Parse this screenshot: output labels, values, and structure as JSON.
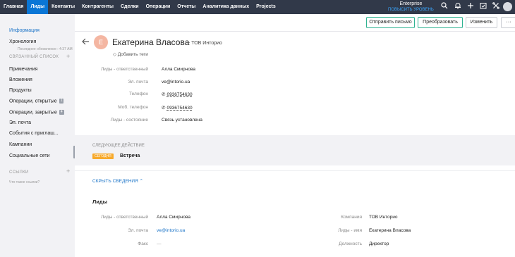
{
  "nav": {
    "items": [
      "Главная",
      "Лиды",
      "Контакты",
      "Контрагенты",
      "Сделки",
      "Операции",
      "Отчеты",
      "Аналитика данных",
      "Projects"
    ],
    "active_index": 1,
    "plan_name": "Enterprise",
    "plan_upgrade": "ПОВЫСИТЬ УРОВЕНЬ",
    "icons": [
      "search-icon",
      "bell-icon",
      "plus-icon",
      "calendar-check-icon",
      "tools-icon",
      "avatar"
    ]
  },
  "sidebar": {
    "info": "Информация",
    "timeline": "Хронология",
    "timeline_updated": "Последнее обновление : 4:37 AM",
    "related_header": "СВЯЗАННЫЙ СПИСОК",
    "related": [
      {
        "label": "Примечания",
        "count": ""
      },
      {
        "label": "Вложения",
        "count": ""
      },
      {
        "label": "Продукты",
        "count": ""
      },
      {
        "label": "Операции, открытые",
        "count": "1"
      },
      {
        "label": "Операции, закрытые",
        "count": "4"
      },
      {
        "label": "Эл. почта",
        "count": ""
      },
      {
        "label": "События с приглаш...",
        "count": ""
      },
      {
        "label": "Кампании",
        "count": ""
      },
      {
        "label": "Социальные сети",
        "count": ""
      }
    ],
    "links_header": "ССЫЛКИ",
    "links_hint": "Что такое ссылки?"
  },
  "actions": {
    "send_email": "Отправить письмо",
    "convert": "Преобразовать",
    "edit": "Изменить",
    "more": "···"
  },
  "record": {
    "avatar_letter": "E",
    "name": "Екатерина Власова",
    "company": "- ТОВ Инторио",
    "add_tags": "Добавить теги"
  },
  "summary": [
    {
      "label": "Лиды - ответственный",
      "value": "Алла Смирнова",
      "type": "text"
    },
    {
      "label": "Эл. почта",
      "value": "ve@intorio.ua",
      "type": "text"
    },
    {
      "label": "Телефон",
      "value": "0936754630",
      "type": "phone"
    },
    {
      "label": "Моб. телефон",
      "value": "0936754630",
      "type": "phone"
    },
    {
      "label": "Лиды - состояние",
      "value": "Связь установлена",
      "type": "text"
    }
  ],
  "next_action": {
    "title": "СЛЕДУЮЩЕЕ ДЕЙСТВИЕ",
    "badge": "СЕГОДНЯ",
    "event": "Встреча"
  },
  "hide_details": "СКРЫТЬ СВЕДЕНИЯ",
  "details": {
    "section_title": "Лиды",
    "left": [
      {
        "label": "Лиды - ответственный",
        "value": "Алла Смирнова",
        "link": false
      },
      {
        "label": "Эл. почта",
        "value": "ve@intorio.ua",
        "link": true
      },
      {
        "label": "Факс",
        "value": "—",
        "link": false
      }
    ],
    "right": [
      {
        "label": "Компания",
        "value": "ТОВ Инторио"
      },
      {
        "label": "Лиды - имя",
        "value": "Екатерина Власова"
      },
      {
        "label": "Должность",
        "value": "Директор"
      }
    ]
  },
  "colors": {
    "nav_bg": "#313949",
    "nav_active": "#0a76d6",
    "accent_link": "#1a73c7",
    "green_border": "#2fb391",
    "today_badge": "#f7a92b"
  }
}
